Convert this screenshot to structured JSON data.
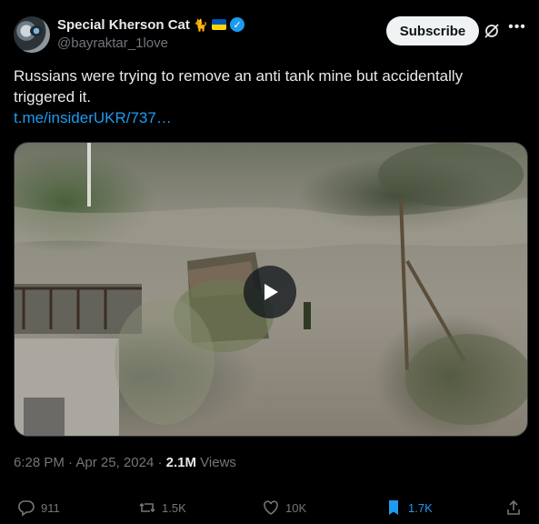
{
  "author": {
    "display_name": "Special Kherson Cat",
    "emoji_icons": [
      "cat-emoji",
      "ukraine-flag-emoji"
    ],
    "handle": "@bayraktar_1love",
    "verified": true
  },
  "header": {
    "subscribe_label": "Subscribe"
  },
  "post": {
    "text": "Russians were trying to remove an anti tank mine but accidentally triggered it.",
    "link": "t.me/insiderUKR/737…"
  },
  "media": {
    "type": "video"
  },
  "meta": {
    "time": "6:28 PM",
    "sep1": " · ",
    "date": "Apr 25, 2024",
    "sep2": " · ",
    "views": "2.1M",
    "views_label": " Views"
  },
  "actions": {
    "replies": "911",
    "reposts": "1.5K",
    "likes": "10K",
    "bookmarks": "1.7K"
  },
  "colors": {
    "accent": "#1d9bf0",
    "muted": "#71767b",
    "text": "#e7e9ea",
    "bg": "#000000"
  }
}
